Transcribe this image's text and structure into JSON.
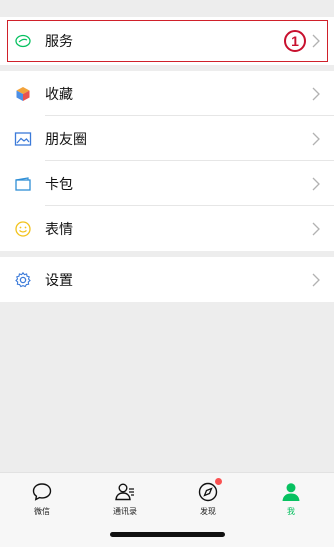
{
  "menu": {
    "service": {
      "label": "服务",
      "marker": "1"
    },
    "items": [
      {
        "label": "收藏",
        "icon": "favorites-cube-icon"
      },
      {
        "label": "朋友圈",
        "icon": "moments-photo-icon"
      },
      {
        "label": "卡包",
        "icon": "card-wallet-icon"
      },
      {
        "label": "表情",
        "icon": "sticker-smile-icon"
      }
    ],
    "settings": {
      "label": "设置",
      "icon": "gear-icon"
    }
  },
  "tabbar": {
    "tabs": [
      {
        "label": "微信",
        "icon": "chat-bubble-icon",
        "active": false
      },
      {
        "label": "通讯录",
        "icon": "contacts-icon",
        "active": false
      },
      {
        "label": "发现",
        "icon": "discover-compass-icon",
        "active": false,
        "badge": true
      },
      {
        "label": "我",
        "icon": "me-person-icon",
        "active": true
      }
    ]
  },
  "colors": {
    "accent": "#07c160",
    "highlight_border": "#d0202a",
    "badge": "#fa5151"
  }
}
